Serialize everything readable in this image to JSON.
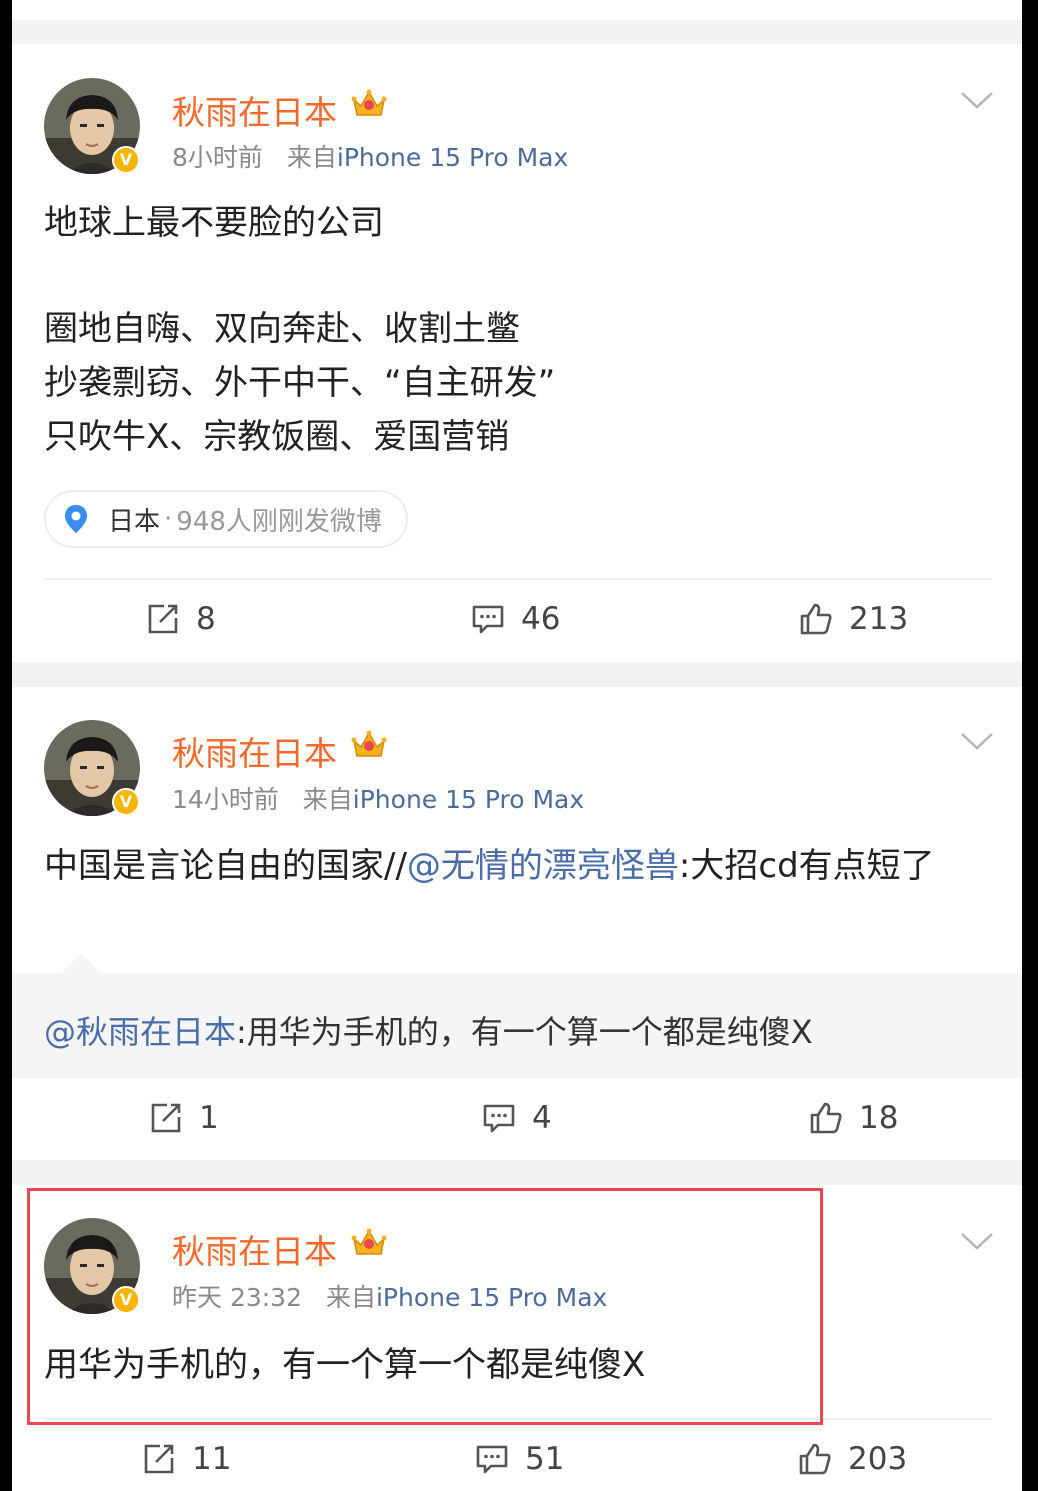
{
  "colors": {
    "username": "#f1692b",
    "meta_gray": "#8a8a8a",
    "link_blue": "#4a6ca8",
    "verified_badge": "#f7b500",
    "location_pin": "#3b8cf0",
    "highlight_border": "#e8484f"
  },
  "icons": {
    "more": "chevron-down-icon",
    "verified": "verified-badge-icon",
    "crown": "crown-icon",
    "location": "location-pin-icon",
    "repost": "repost-icon",
    "comment": "comment-icon",
    "like": "like-icon"
  },
  "posts": [
    {
      "username": "秋雨在日本",
      "time": "8小时前",
      "source_prefix": "来自",
      "device": "iPhone 15 Pro Max",
      "verified_mark": "V",
      "lines": [
        "地球上最不要脸的公司",
        "圈地自嗨、双向奔赴、收割土鳖",
        "抄袭剽窃、外干中干、“自主研发”",
        "只吹牛X、宗教饭圈、爱国营销"
      ],
      "location": "日本",
      "location_sep": "·",
      "location_note": "948人刚刚发微博",
      "reposts": "8",
      "comments": "46",
      "likes": "213"
    },
    {
      "username": "秋雨在日本",
      "time": "14小时前",
      "source_prefix": "来自",
      "device": "iPhone 15 Pro Max",
      "verified_mark": "V",
      "text_prefix": "中国是言论自由的国家//",
      "text_mention": "@无情的漂亮怪兽",
      "text_suffix": ":大招cd有点短了",
      "repost_mention": "@秋雨在日本",
      "repost_text": ":用华为手机的，有一个算一个都是纯傻X",
      "reposts": "1",
      "comments": "4",
      "likes": "18"
    },
    {
      "username": "秋雨在日本",
      "time": "昨天 23:32",
      "source_prefix": "来自",
      "device": "iPhone 15 Pro Max",
      "verified_mark": "V",
      "text": "用华为手机的，有一个算一个都是纯傻X",
      "reposts": "11",
      "comments": "51",
      "likes": "203"
    }
  ]
}
